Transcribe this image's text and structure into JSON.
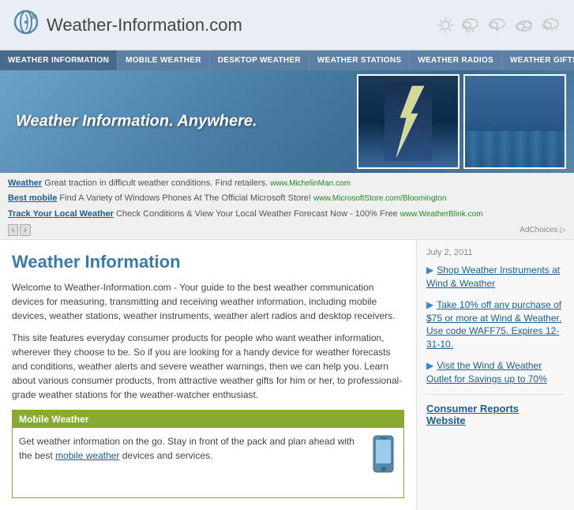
{
  "site": {
    "title": "Weather-Information.com",
    "logo_symbol": "◌",
    "banner_tagline": "Weather Information. Anywhere."
  },
  "nav": {
    "items": [
      {
        "label": "WEATHER INFORMATION",
        "active": true
      },
      {
        "label": "MOBILE WEATHER"
      },
      {
        "label": "DESKTOP WEATHER"
      },
      {
        "label": "WEATHER STATIONS"
      },
      {
        "label": "WEATHER RADIOS"
      },
      {
        "label": "WEATHER GIFTS"
      }
    ]
  },
  "ads": {
    "rows": [
      {
        "link_text": "Weather",
        "description": " Great traction in difficult weather conditions. Find retailers.",
        "url_text": "www.MichelinMan.com"
      },
      {
        "link_text": "Best mobile",
        "description": " Find A Variety of Windows Phones At The Official Microsoft Store!",
        "url_text": "www.MicrosoftStore.com/Bloomington"
      },
      {
        "link_text": "Track Your Local Weather",
        "description": " Check Conditions & View Your Local Weather Forecast Now - 100% Free",
        "url_text": "www.WeatherBlink.com"
      }
    ],
    "adchoices_label": "AdChoices ▷"
  },
  "content": {
    "title": "Weather Information",
    "para1": "Welcome to Weather-Information.com - Your guide to the best weather communication devices for measuring, transmitting and receiving weather information, including mobile devices, weather stations, weather instruments, weather alert radios and desktop receivers.",
    "para2": "This site features everyday consumer products for people who want weather information, wherever they choose to be. So if you are looking for a handy device for weather forecasts and conditions, weather alerts and severe weather warnings, then we can help you. Learn about various consumer products, from attractive weather gifts for him or her, to professional-grade weather stations for the weather-watcher enthusiast.",
    "mobile_box": {
      "header": "Mobile Weather",
      "body": "Get weather information on the go. Stay in front of the pack and plan ahead with the best",
      "link_text": "mobile weather",
      "body_end": " devices and services."
    }
  },
  "sidebar": {
    "date": "July 2, 2011",
    "links": [
      {
        "text": "Shop Weather Instruments at Wind & Weather"
      },
      {
        "text": "Take 10% off any purchase of $75 or more at Wind & Weather. Use code WAFF75. Expires 12-31-10."
      },
      {
        "text": "Visit the Wind & Weather Outlet for Savings up to 70%"
      }
    ],
    "consumer_reports_link": "Consumer Reports",
    "consumer_reports_website": "Website"
  }
}
